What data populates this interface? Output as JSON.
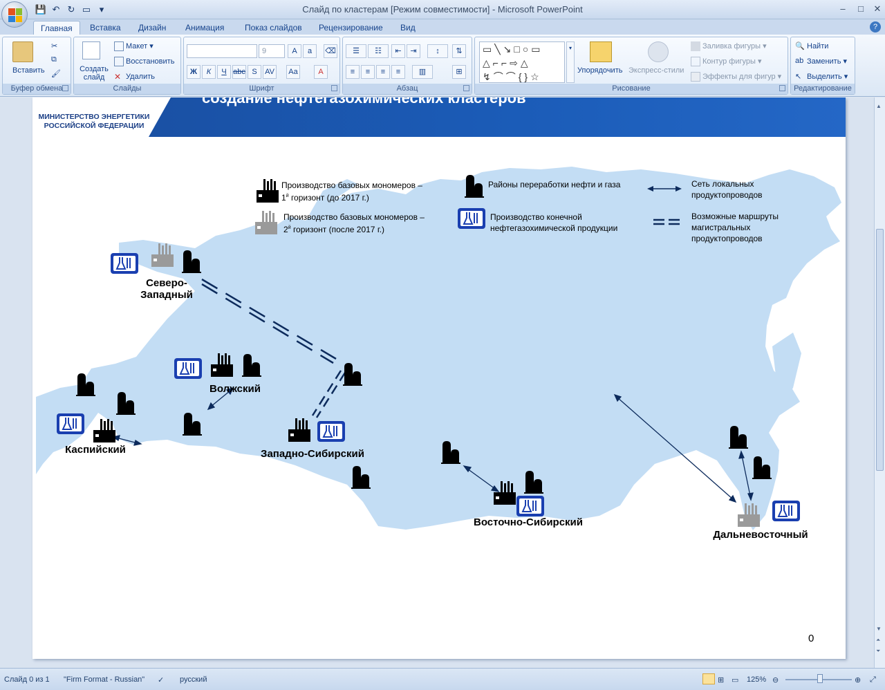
{
  "window": {
    "title": "Слайд по кластерам [Режим совместимости] - Microsoft PowerPoint"
  },
  "tabs": [
    "Главная",
    "Вставка",
    "Дизайн",
    "Анимация",
    "Показ слайдов",
    "Рецензирование",
    "Вид"
  ],
  "ribbon": {
    "clipboard": {
      "label": "Буфер обмена",
      "paste": "Вставить"
    },
    "slides": {
      "label": "Слайды",
      "new_slide": "Создать слайд",
      "layout": "Макет",
      "reset": "Восстановить",
      "delete": "Удалить"
    },
    "font": {
      "label": "Шрифт",
      "size": "9"
    },
    "paragraph": {
      "label": "Абзац"
    },
    "drawing": {
      "label": "Рисование",
      "arrange": "Упорядочить",
      "quick_styles": "Экспресс-стили",
      "fill": "Заливка фигуры",
      "outline": "Контур фигуры",
      "effects": "Эффекты для фигур"
    },
    "editing": {
      "label": "Редактирование",
      "find": "Найти",
      "replace": "Заменить",
      "select": "Выделить"
    }
  },
  "slide": {
    "ministry": "МИНИСТЕРСТВО ЭНЕРГЕТИКИ РОССИЙСКОЙ ФЕДЕРАЦИИ",
    "title": "создание нефтегазохимических кластеров",
    "legend": {
      "mono1_line1": "Производство базовых мономеров –",
      "mono1_line2_a": "1",
      "mono1_sup": "й",
      "mono1_line2_b": " горизонт (до 2017  г.)",
      "mono2_line1": "Производство базовых мономеров –",
      "mono2_line2_a": "2",
      "mono2_sup": "й",
      "mono2_line2_b": " горизонт (после 2017  г.)",
      "refining": "Районы переработки нефти и газа",
      "final_line1": "Производство конечной",
      "final_line2": "нефтегазохимической продукции",
      "local_line1": "Сеть локальных",
      "local_line2": "продуктопроводов",
      "trunk_line1": "Возможные маршруты",
      "trunk_line2": "магистральных",
      "trunk_line3": "продуктопроводов"
    },
    "clusters": {
      "northwest_1": "Северо-",
      "northwest_2": "Западный",
      "volga": "Волжский",
      "caspian": "Каспийский",
      "west_siberia": "Западно-Сибирский",
      "east_siberia": "Восточно-Сибирский",
      "far_east": "Дальневосточный"
    },
    "page_number": "0"
  },
  "status": {
    "slide": "Слайд 0 из 1",
    "theme": "\"Firm Format - Russian\"",
    "language": "русский",
    "zoom": "125%"
  },
  "colors": {
    "map_land": "#c3ddf4",
    "banner": "#1b5cb8",
    "flask_blue": "#1a3fb0"
  }
}
